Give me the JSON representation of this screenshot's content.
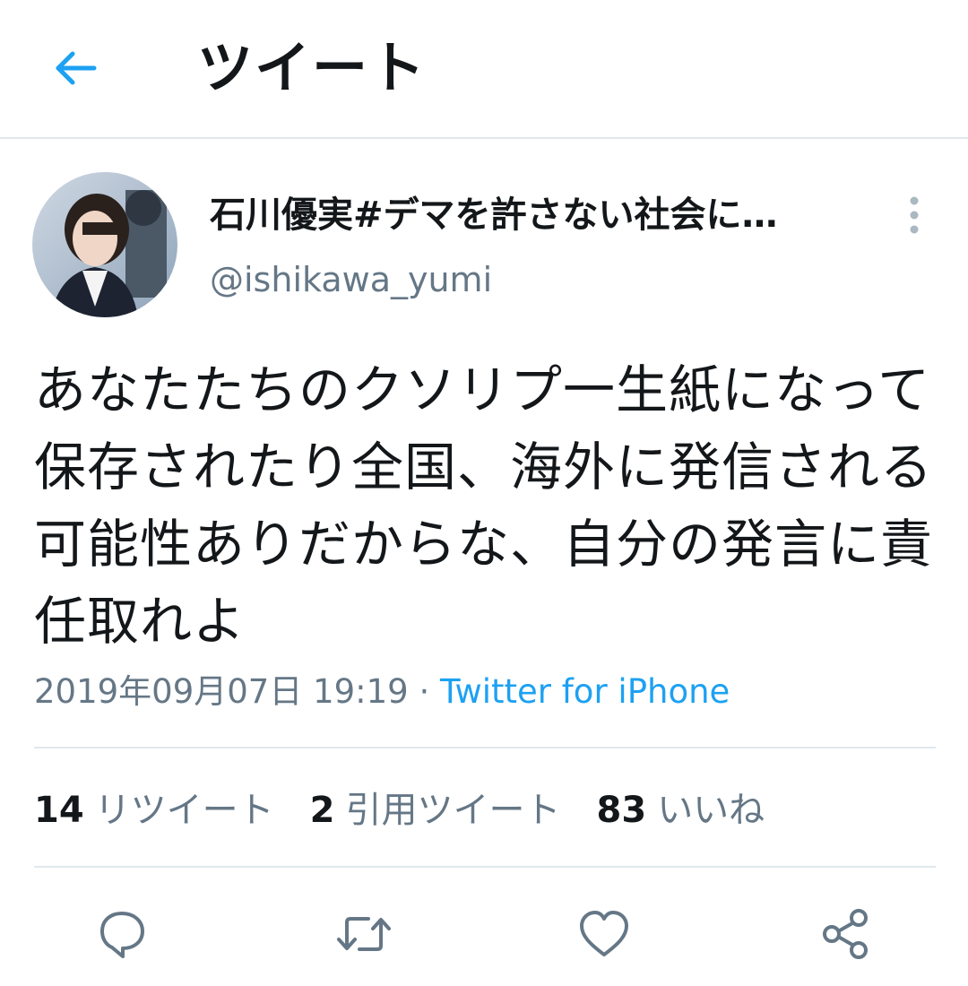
{
  "header": {
    "title": "ツイート"
  },
  "tweet": {
    "display_name": "石川優実#デマを許さない社会に…",
    "handle": "@ishikawa_yumi",
    "text": "あなたたちのクソリプ一生紙になって保存されたり全国、海外に発信される可能性ありだからな、自分の発言に責任取れよ",
    "timestamp": "2019年09月07日 19:19",
    "separator": "·",
    "source": "Twitter for iPhone"
  },
  "stats": {
    "retweets_count": "14",
    "retweets_label": "リツイート",
    "quotes_count": "2",
    "quotes_label": "引用ツイート",
    "likes_count": "83",
    "likes_label": "いいね"
  },
  "icons": {
    "back": "arrow-left-icon",
    "more": "vertical-ellipsis-icon",
    "reply": "reply-icon",
    "retweet": "retweet-icon",
    "like": "heart-icon",
    "share": "share-icon"
  },
  "colors": {
    "accent": "#1da1f2",
    "text": "#14171a",
    "secondary": "#657786",
    "divider": "#e1e8ed"
  }
}
